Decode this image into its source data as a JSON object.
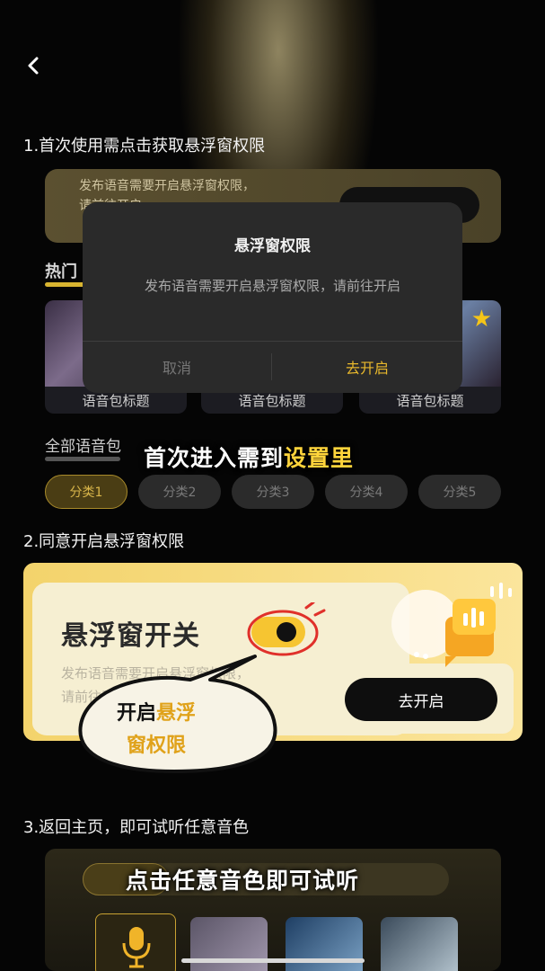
{
  "steps": {
    "step1": "1.首次使用需点击获取悬浮窗权限",
    "step2": "2.同意开启悬浮窗权限",
    "step3": "3.返回主页，即可试听任意音色"
  },
  "step1_bg": {
    "card_text_1": "发布语音需要开启悬浮窗权限，",
    "card_text_2": "请前往开启",
    "hot_label": "热门",
    "thumb_captions": [
      "语音包标题",
      "语音包标题",
      "语音包标题"
    ],
    "all_label": "全部语音包",
    "chips": [
      "分类1",
      "分类2",
      "分类3",
      "分类4",
      "分类5"
    ]
  },
  "dialog": {
    "title": "悬浮窗权限",
    "message": "发布语音需要开启悬浮窗权限，请前往开启",
    "cancel": "取消",
    "confirm": "去开启"
  },
  "overlay1": {
    "prefix": "首次进入需到",
    "highlight": "设置里"
  },
  "step2_card": {
    "title": "悬浮窗开关",
    "desc1": "发布语音需要开启悬浮窗权限，",
    "desc2": "请前往开启",
    "button": "去开启"
  },
  "bubble": {
    "prefix": "开启",
    "highlight1": "悬浮",
    "highlight2": "窗权限"
  },
  "overlay3": {
    "text": "点击任意音色即可试听"
  },
  "colors": {
    "accent": "#e8b82c",
    "highlight": "#ffd43b",
    "card_yellow": "#f3d36b"
  },
  "icons": {
    "back": "chevron-left-icon",
    "star": "star-icon",
    "mic": "microphone-icon",
    "toggle": "toggle-icon"
  }
}
